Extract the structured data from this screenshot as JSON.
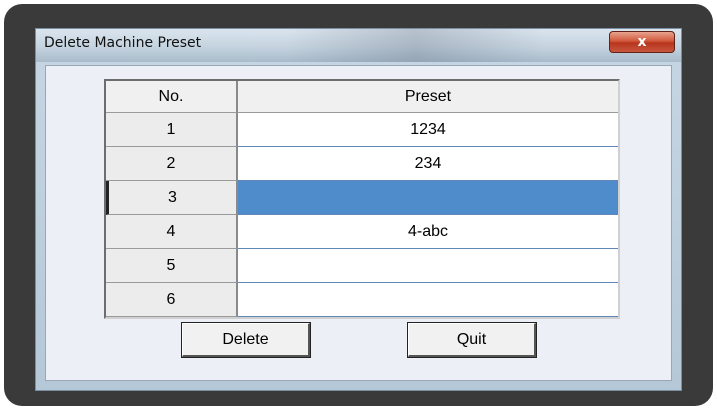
{
  "window": {
    "title": "Delete Machine Preset",
    "close_glyph": "x"
  },
  "table": {
    "headers": {
      "no": "No.",
      "preset": "Preset"
    },
    "rows": [
      {
        "no": "1",
        "preset": "1234"
      },
      {
        "no": "2",
        "preset": "234"
      },
      {
        "no": "3",
        "preset": ""
      },
      {
        "no": "4",
        "preset": "4-abc"
      },
      {
        "no": "5",
        "preset": ""
      },
      {
        "no": "6",
        "preset": ""
      }
    ],
    "selected_row": "3"
  },
  "buttons": {
    "delete_label": "Delete",
    "quit_label": "Quit"
  },
  "colors": {
    "selection": "#4f8ccb",
    "close_button": "#c9452b"
  },
  "icons": {
    "close": "close-icon"
  }
}
